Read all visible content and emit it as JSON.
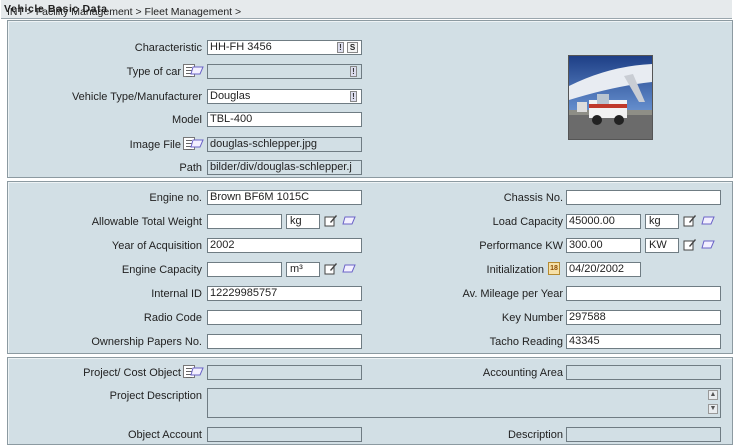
{
  "breadcrumb": {
    "path": "INT > Facility Management > Fleet Management > ",
    "current": "Vehicle Basic Data"
  },
  "section1": {
    "characteristic": {
      "label": "Characteristic",
      "value": "HH-FH 3456",
      "btn_s": "S",
      "btn_info": "!"
    },
    "type_of_car": {
      "label": "Type of car",
      "value": ""
    },
    "vehicle_type": {
      "label": "Vehicle Type/Manufacturer",
      "value": "Douglas"
    },
    "model": {
      "label": "Model",
      "value": "TBL-400"
    },
    "image_file": {
      "label": "Image File",
      "value": "douglas-schlepper.jpg"
    },
    "path": {
      "label": "Path",
      "value": "bilder/div/douglas-schlepper.j"
    }
  },
  "section2": {
    "engine_no": {
      "label": "Engine no.",
      "value": "Brown BF6M 1015C"
    },
    "allowable_weight": {
      "label": "Allowable Total Weight",
      "value": "",
      "unit": "kg"
    },
    "year": {
      "label": "Year of Acquisition",
      "value": "2002"
    },
    "engine_capacity": {
      "label": "Engine Capacity",
      "value": "",
      "unit": "m³"
    },
    "internal_id": {
      "label": "Internal ID",
      "value": "12229985757"
    },
    "radio_code": {
      "label": "Radio Code",
      "value": ""
    },
    "ownership_papers": {
      "label": "Ownership Papers No.",
      "value": ""
    },
    "chassis_no": {
      "label": "Chassis No.",
      "value": ""
    },
    "load_capacity": {
      "label": "Load Capacity",
      "value": "45000.00",
      "unit": "kg"
    },
    "performance": {
      "label": "Performance KW",
      "value": "300.00",
      "unit": "KW"
    },
    "initialization": {
      "label": "Initialization",
      "value": "04/20/2002",
      "cal": "18"
    },
    "mileage": {
      "label": "Av. Mileage per Year",
      "value": ""
    },
    "key_number": {
      "label": "Key Number",
      "value": "297588"
    },
    "tacho": {
      "label": "Tacho Reading",
      "value": "43345"
    }
  },
  "section3": {
    "project": {
      "label": "Project/ Cost Object",
      "value": ""
    },
    "accounting_area": {
      "label": "Accounting Area",
      "value": ""
    },
    "project_description": {
      "label": "Project Description",
      "value": ""
    },
    "object_account": {
      "label": "Object Account",
      "value": ""
    },
    "description": {
      "label": "Description",
      "value": ""
    }
  },
  "icons": {
    "list": "list-select-icon",
    "eraser": "eraser-icon",
    "edit": "edit-icon",
    "calendar": "calendar-icon"
  },
  "colors": {
    "panel": "#d2dfe5",
    "titlebar": "#e6eaec",
    "border": "#8c9aa1"
  }
}
